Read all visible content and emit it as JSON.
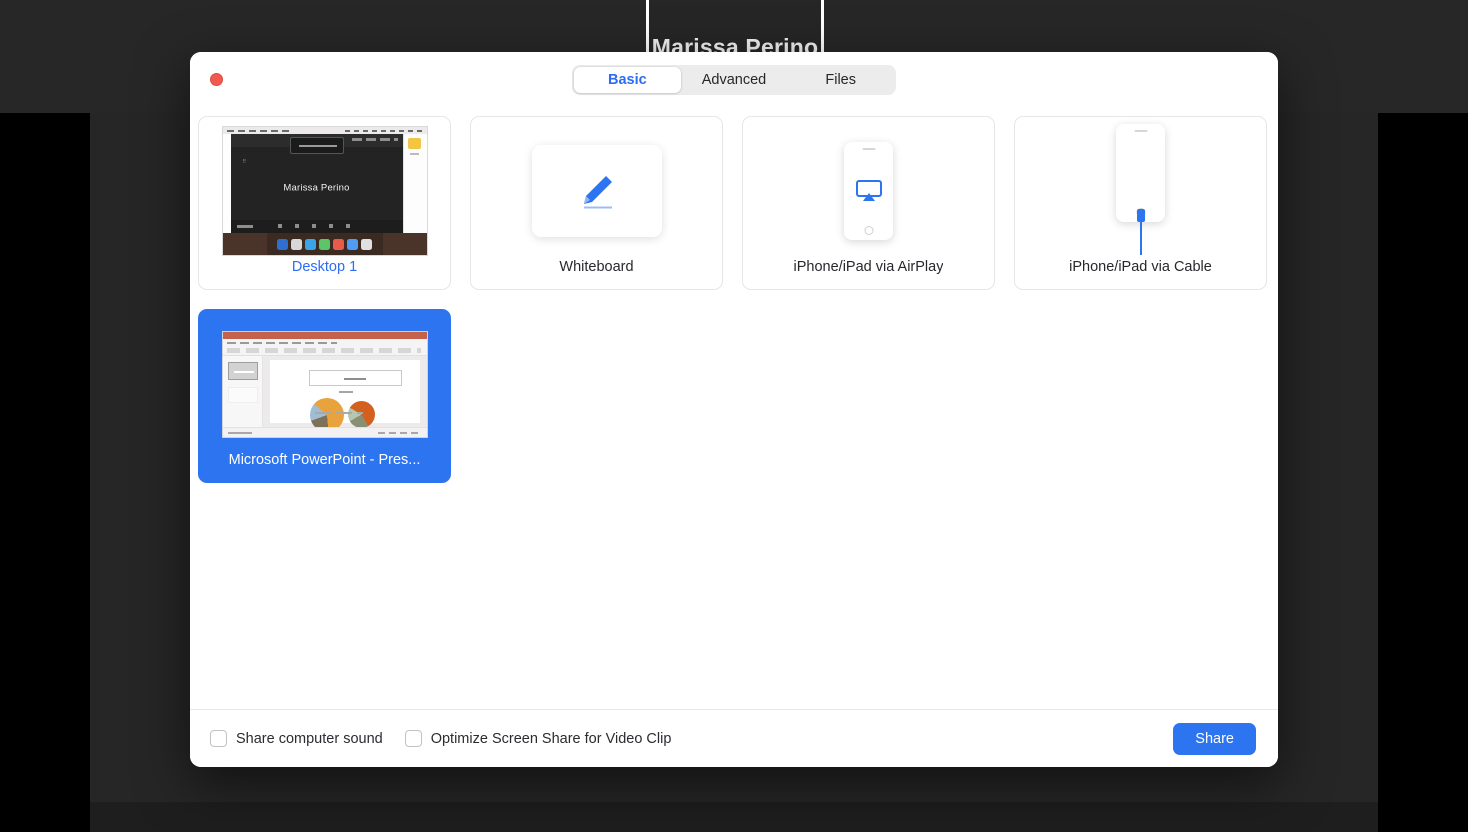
{
  "backdrop": {
    "participant_name": "Marissa Perino"
  },
  "dialog": {
    "close_button_label": "Close",
    "tabs": [
      {
        "label": "Basic",
        "active": true
      },
      {
        "label": "Advanced",
        "active": false
      },
      {
        "label": "Files",
        "active": false
      }
    ],
    "tiles": [
      {
        "label": "Desktop 1",
        "kind": "screen",
        "selected": false,
        "accent": true,
        "screen_name": "Marissa Perino"
      },
      {
        "label": "Whiteboard",
        "kind": "whiteboard",
        "selected": false,
        "accent": false
      },
      {
        "label": "iPhone/iPad via AirPlay",
        "kind": "airplay",
        "selected": false,
        "accent": false
      },
      {
        "label": "iPhone/iPad via Cable",
        "kind": "cable",
        "selected": false,
        "accent": false
      },
      {
        "label": "Microsoft PowerPoint - Pres...",
        "kind": "powerpoint",
        "selected": true,
        "accent": false
      }
    ],
    "footer": {
      "share_computer_sound": {
        "label": "Share computer sound",
        "checked": false
      },
      "optimize_video_clip": {
        "label": "Optimize Screen Share for Video Clip",
        "checked": false
      },
      "share_button_label": "Share"
    }
  },
  "colors": {
    "accent_blue": "#2d74f0",
    "tab_active_text": "#2d6cf6",
    "close_red": "#f3584e",
    "selected_tile": "#2d74f0"
  }
}
